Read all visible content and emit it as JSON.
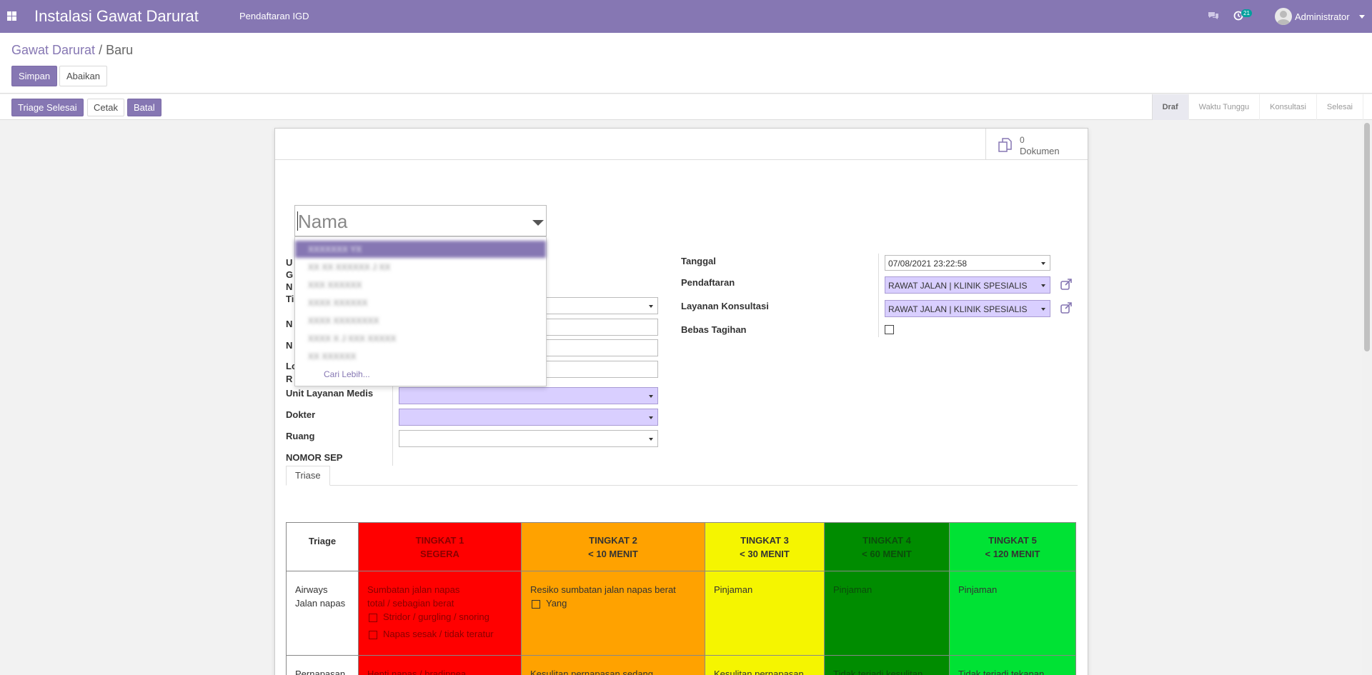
{
  "navbar": {
    "app_title": "Instalasi Gawat Darurat",
    "menu": "Pendaftaran IGD",
    "activity_count": "21",
    "user": "Administrator"
  },
  "breadcrumb": {
    "parent": "Gawat Darurat",
    "separator": "/",
    "current": "Baru"
  },
  "actions": {
    "save": "Simpan",
    "discard": "Abaikan"
  },
  "statusbar": {
    "buttons": [
      "Triage Selesai",
      "Cetak",
      "Batal"
    ],
    "stages": [
      "Draf",
      "Waktu Tunggu",
      "Konsultasi",
      "Selesai"
    ],
    "active_stage": "Draf"
  },
  "smart_button": {
    "count": "0",
    "label": "Dokumen"
  },
  "nama": {
    "placeholder": "Nama",
    "dropdown_items": [
      "XXXXXXX YX",
      "XX XX XXXXXX J XX",
      "XXX XXXXXX",
      "XXXX XXXXXX",
      "XXXX XXXXXXXX",
      "XXXX X J XXX XXXXX",
      "XX XXXXXX"
    ],
    "more": "Cari Lebih..."
  },
  "left_fields": {
    "hidden_labels": [
      "U",
      "G",
      "N",
      "Ti",
      "N",
      "N",
      "Lo",
      "R"
    ],
    "unit_layanan_medis": "Unit Layanan Medis",
    "dokter": "Dokter",
    "ruang": "Ruang",
    "nomor_sep": "NOMOR SEP"
  },
  "right_fields": {
    "tanggal_label": "Tanggal",
    "tanggal_value": "07/08/2021 23:22:58",
    "pendaftaran_label": "Pendaftaran",
    "pendaftaran_value": "RAWAT JALAN | KLINIK SPESIALIS",
    "layanan_label": "Layanan Konsultasi",
    "layanan_value": "RAWAT JALAN | KLINIK SPESIALIS",
    "bebas_label": "Bebas Tagihan"
  },
  "tab": "Triase",
  "triage": {
    "corner": "Triage",
    "levels": [
      {
        "title": "TINGKAT 1",
        "sub": "SEGERA"
      },
      {
        "title": "TINGKAT 2",
        "sub": "< 10 MENIT"
      },
      {
        "title": "TINGKAT 3",
        "sub": "< 30 MENIT"
      },
      {
        "title": "TINGKAT 4",
        "sub": "< 60 MENIT"
      },
      {
        "title": "TINGKAT 5",
        "sub": "< 120 MENIT"
      }
    ],
    "airways": {
      "label1": "Airways",
      "label2": "Jalan napas",
      "t1_line1": "Sumbatan jalan napas",
      "t1_line2": "total / sebagian berat",
      "t1_opt1": "Stridor / gurgling / snoring",
      "t1_opt2": "Napas sesak / tidak teratur",
      "t2_line": "Resiko sumbatan jalan napas berat",
      "t2_opt": "Yang",
      "t3": "Pinjaman",
      "t4": "Pinjaman",
      "t5": "Pinjaman"
    },
    "pernapasan": {
      "label": "Pernapasan",
      "t1": "Henti napas / bradipnea",
      "t2": "Kesulitan pernapasan sedang",
      "t3": "Kesulitan pernapasan",
      "t4": "Tidak terjadi kesulitan",
      "t5": "Tidak terjadi tekanan"
    }
  }
}
